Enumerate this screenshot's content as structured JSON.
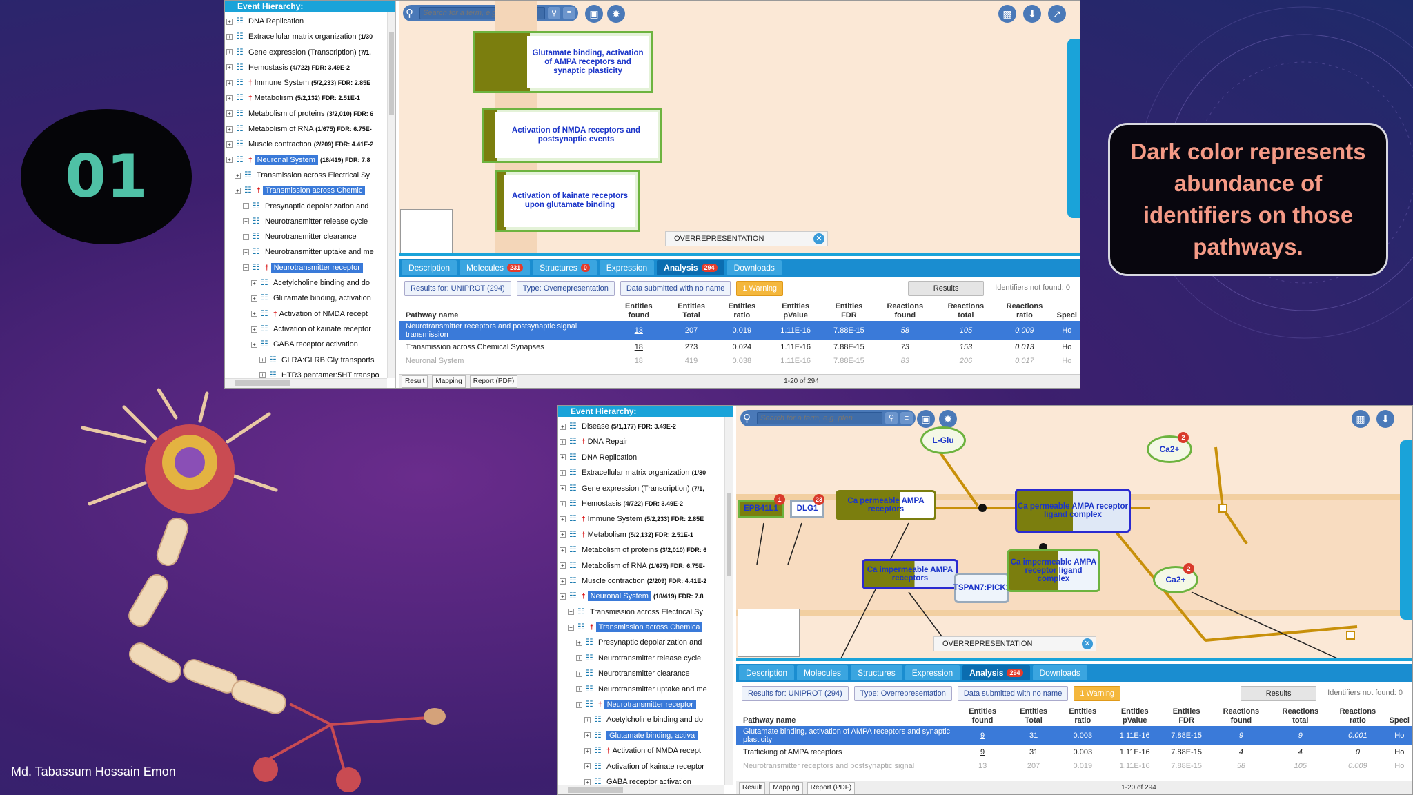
{
  "slide": {
    "number": "01",
    "callout": "Dark color represents abundance of identifiers on those pathways.",
    "author": "Md. Tabassum Hossain Emon"
  },
  "shot1": {
    "hier_title": "Event Hierarchy:",
    "tree": [
      {
        "label": "DNA Replication",
        "stats": "",
        "flag": false
      },
      {
        "label": "Extracellular matrix organization",
        "stats": "(1/30",
        "flag": false
      },
      {
        "label": "Gene expression (Transcription)",
        "stats": "(7/1,",
        "flag": false
      },
      {
        "label": "Hemostasis",
        "stats": "(4/722) FDR: 3.49E-2",
        "flag": false
      },
      {
        "label": "Immune System",
        "stats": "(5/2,233) FDR: 2.85E",
        "flag": true
      },
      {
        "label": "Metabolism",
        "stats": "(5/2,132) FDR: 2.51E-1",
        "flag": true
      },
      {
        "label": "Metabolism of proteins",
        "stats": "(3/2,010) FDR: 6",
        "flag": false
      },
      {
        "label": "Metabolism of RNA",
        "stats": "(1/675) FDR: 6.75E-",
        "flag": false
      },
      {
        "label": "Muscle contraction",
        "stats": "(2/209) FDR: 4.41E-2",
        "flag": false
      },
      {
        "label": "Neuronal System",
        "stats": "(18/419) FDR: 7.8",
        "flag": true,
        "selected": true
      },
      {
        "label": "Transmission across Electrical Sy",
        "stats": "",
        "flag": false
      },
      {
        "label": "Transmission across Chemic",
        "stats": "",
        "flag": true,
        "selected": true
      },
      {
        "label": "Presynaptic depolarization and",
        "stats": "",
        "flag": false
      },
      {
        "label": "Neurotransmitter release cycle",
        "stats": "",
        "flag": false
      },
      {
        "label": "Neurotransmitter clearance",
        "stats": "",
        "flag": false
      },
      {
        "label": "Neurotransmitter uptake and me",
        "stats": "",
        "flag": false
      },
      {
        "label": "Neurotransmitter receptor",
        "stats": "",
        "flag": true,
        "selected": true
      },
      {
        "label": "Acetylcholine binding and do",
        "stats": "",
        "flag": false
      },
      {
        "label": "Glutamate binding, activation",
        "stats": "",
        "flag": false
      },
      {
        "label": "Activation of NMDA recept",
        "stats": "",
        "flag": true
      },
      {
        "label": "Activation of kainate receptor",
        "stats": "",
        "flag": false
      },
      {
        "label": "GABA receptor activation",
        "stats": "",
        "flag": false
      },
      {
        "label": "GLRA:GLRB:Gly transports",
        "stats": "",
        "flag": false
      },
      {
        "label": "HTR3 pentamer:5HT transpo",
        "stats": "",
        "flag": false
      }
    ],
    "search_placeholder": "Search for a term, e.g. pten",
    "nodes": [
      "Glutamate binding, activation of AMPA receptors and synaptic plasticity",
      "Activation of NMDA receptors and postsynaptic events",
      "Activation of kainate receptors upon glutamate binding"
    ],
    "overlay": "OVERREPRESENTATION",
    "tabs": [
      {
        "label": "Description",
        "badge": ""
      },
      {
        "label": "Molecules",
        "badge": "231"
      },
      {
        "label": "Structures",
        "badge": "0"
      },
      {
        "label": "Expression",
        "badge": ""
      },
      {
        "label": "Analysis",
        "badge": "294",
        "active": true
      },
      {
        "label": "Downloads",
        "badge": ""
      }
    ],
    "filters": {
      "results_for": "Results for:  UNIPROT (294)",
      "type": "Type: Overrepresentation",
      "submitted": "Data submitted with no name",
      "warning": "1 Warning",
      "results": "Results",
      "not_found": "Identifiers not found: 0"
    },
    "headers": [
      "Pathway name",
      "Entities found",
      "Entities Total",
      "Entities ratio",
      "Entities pValue",
      "Entities FDR",
      "Reactions found",
      "Reactions total",
      "Reactions ratio",
      "Speci"
    ],
    "rows": [
      {
        "name": "Neurotransmitter receptors and postsynaptic signal transmission",
        "found": "13",
        "total": "207",
        "ratio": "0.019",
        "p": "1.11E-16",
        "fdr": "7.88E-15",
        "rf": "58",
        "rt": "105",
        "rr": "0.009",
        "sp": "Ho",
        "hl": true
      },
      {
        "name": "Transmission across Chemical Synapses",
        "found": "18",
        "total": "273",
        "ratio": "0.024",
        "p": "1.11E-16",
        "fdr": "7.88E-15",
        "rf": "73",
        "rt": "153",
        "rr": "0.013",
        "sp": "Ho"
      },
      {
        "name": "Neuronal System",
        "found": "18",
        "total": "419",
        "ratio": "0.038",
        "p": "1.11E-16",
        "fdr": "7.88E-15",
        "rf": "83",
        "rt": "206",
        "rr": "0.017",
        "sp": "Ho",
        "faded": true
      }
    ],
    "footer": {
      "result": "Result",
      "mapping": "Mapping",
      "report": "Report (PDF)",
      "pager": "1-20 of 294"
    }
  },
  "shot2": {
    "hier_title": "Event Hierarchy:",
    "tree": [
      {
        "label": "Disease",
        "stats": "(5/1,177) FDR: 3.49E-2",
        "flag": false
      },
      {
        "label": "DNA Repair",
        "stats": "",
        "flag": true
      },
      {
        "label": "DNA Replication",
        "stats": "",
        "flag": false
      },
      {
        "label": "Extracellular matrix organization",
        "stats": "(1/30",
        "flag": false
      },
      {
        "label": "Gene expression (Transcription)",
        "stats": "(7/1,",
        "flag": false
      },
      {
        "label": "Hemostasis",
        "stats": "(4/722) FDR: 3.49E-2",
        "flag": false
      },
      {
        "label": "Immune System",
        "stats": "(5/2,233) FDR: 2.85E",
        "flag": true
      },
      {
        "label": "Metabolism",
        "stats": "(5/2,132) FDR: 2.51E-1",
        "flag": true
      },
      {
        "label": "Metabolism of proteins",
        "stats": "(3/2,010) FDR: 6",
        "flag": false
      },
      {
        "label": "Metabolism of RNA",
        "stats": "(1/675) FDR: 6.75E-",
        "flag": false
      },
      {
        "label": "Muscle contraction",
        "stats": "(2/209) FDR: 4.41E-2",
        "flag": false
      },
      {
        "label": "Neuronal System",
        "stats": "(18/419) FDR: 7.8",
        "flag": true,
        "selected": true
      },
      {
        "label": "Transmission across Electrical Sy",
        "stats": "",
        "flag": false
      },
      {
        "label": "Transmission across Chemica",
        "stats": "",
        "flag": true,
        "selected": true
      },
      {
        "label": "Presynaptic depolarization and",
        "stats": "",
        "flag": false
      },
      {
        "label": "Neurotransmitter release cycle",
        "stats": "",
        "flag": false
      },
      {
        "label": "Neurotransmitter clearance",
        "stats": "",
        "flag": false
      },
      {
        "label": "Neurotransmitter uptake and me",
        "stats": "",
        "flag": false
      },
      {
        "label": "Neurotransmitter receptor",
        "stats": "",
        "flag": true,
        "selected": true
      },
      {
        "label": "Acetylcholine binding and do",
        "stats": "",
        "flag": false
      },
      {
        "label": "Glutamate binding, activa",
        "stats": "",
        "flag": false,
        "selected": true
      },
      {
        "label": "Activation of NMDA recept",
        "stats": "",
        "flag": true
      },
      {
        "label": "Activation of kainate receptor",
        "stats": "",
        "flag": false
      },
      {
        "label": "GABA receptor activation",
        "stats": "",
        "flag": false
      }
    ],
    "search_placeholder": "Search for a term, e.g. pten",
    "molecules": {
      "lglu": "L-Glu",
      "ca1": "Ca2+",
      "ca2": "Ca2+",
      "epb": "EPB41L1",
      "dlg": "DLG1",
      "ampa_perm": "Ca permeable AMPA receptors",
      "ampa_lig": "Ca permeable AMPA receptor ligand complex",
      "ampa_imp": "Ca impermeable AMPA receptors",
      "tspan": "TSPAN7:PICK1",
      "imp_lig": "Ca impermeable AMPA receptor ligand complex",
      "c_epb": "1",
      "c_dlg": "23",
      "c_ca1": "2",
      "c_ca2": "2"
    },
    "overlay": "OVERREPRESENTATION",
    "tabs": [
      {
        "label": "Description",
        "badge": ""
      },
      {
        "label": "Molecules",
        "badge": ""
      },
      {
        "label": "Structures",
        "badge": ""
      },
      {
        "label": "Expression",
        "badge": ""
      },
      {
        "label": "Analysis",
        "badge": "294",
        "active": true
      },
      {
        "label": "Downloads",
        "badge": ""
      }
    ],
    "filters": {
      "results_for": "Results for:  UNIPROT (294)",
      "type": "Type: Overrepresentation",
      "submitted": "Data submitted with no name",
      "warning": "1 Warning",
      "results": "Results",
      "not_found": "Identifiers not found: 0"
    },
    "headers": [
      "Pathway name",
      "Entities found",
      "Entities Total",
      "Entities ratio",
      "Entities pValue",
      "Entities FDR",
      "Reactions found",
      "Reactions total",
      "Reactions ratio",
      "Speci"
    ],
    "rows": [
      {
        "name": "Glutamate binding, activation of AMPA receptors and synaptic plasticity",
        "found": "9",
        "total": "31",
        "ratio": "0.003",
        "p": "1.11E-16",
        "fdr": "7.88E-15",
        "rf": "9",
        "rt": "9",
        "rr": "0.001",
        "sp": "Ho",
        "hl": true
      },
      {
        "name": "Trafficking of AMPA receptors",
        "found": "9",
        "total": "31",
        "ratio": "0.003",
        "p": "1.11E-16",
        "fdr": "7.88E-15",
        "rf": "4",
        "rt": "4",
        "rr": "0",
        "sp": "Ho"
      },
      {
        "name": "Neurotransmitter receptors and postsynaptic signal",
        "found": "13",
        "total": "207",
        "ratio": "0.019",
        "p": "1.11E-16",
        "fdr": "7.88E-15",
        "rf": "58",
        "rt": "105",
        "rr": "0.009",
        "sp": "Ho",
        "faded": true
      }
    ],
    "footer": {
      "result": "Result",
      "mapping": "Mapping",
      "report": "Report (PDF)",
      "pager": "1-20 of 294"
    }
  },
  "colors": {
    "accent": "#1aa3d9",
    "highlight": "#3a7ad9",
    "dark_node": "#7b7e0e",
    "number": "#4fc1a6",
    "callout_text": "#f49a86"
  }
}
